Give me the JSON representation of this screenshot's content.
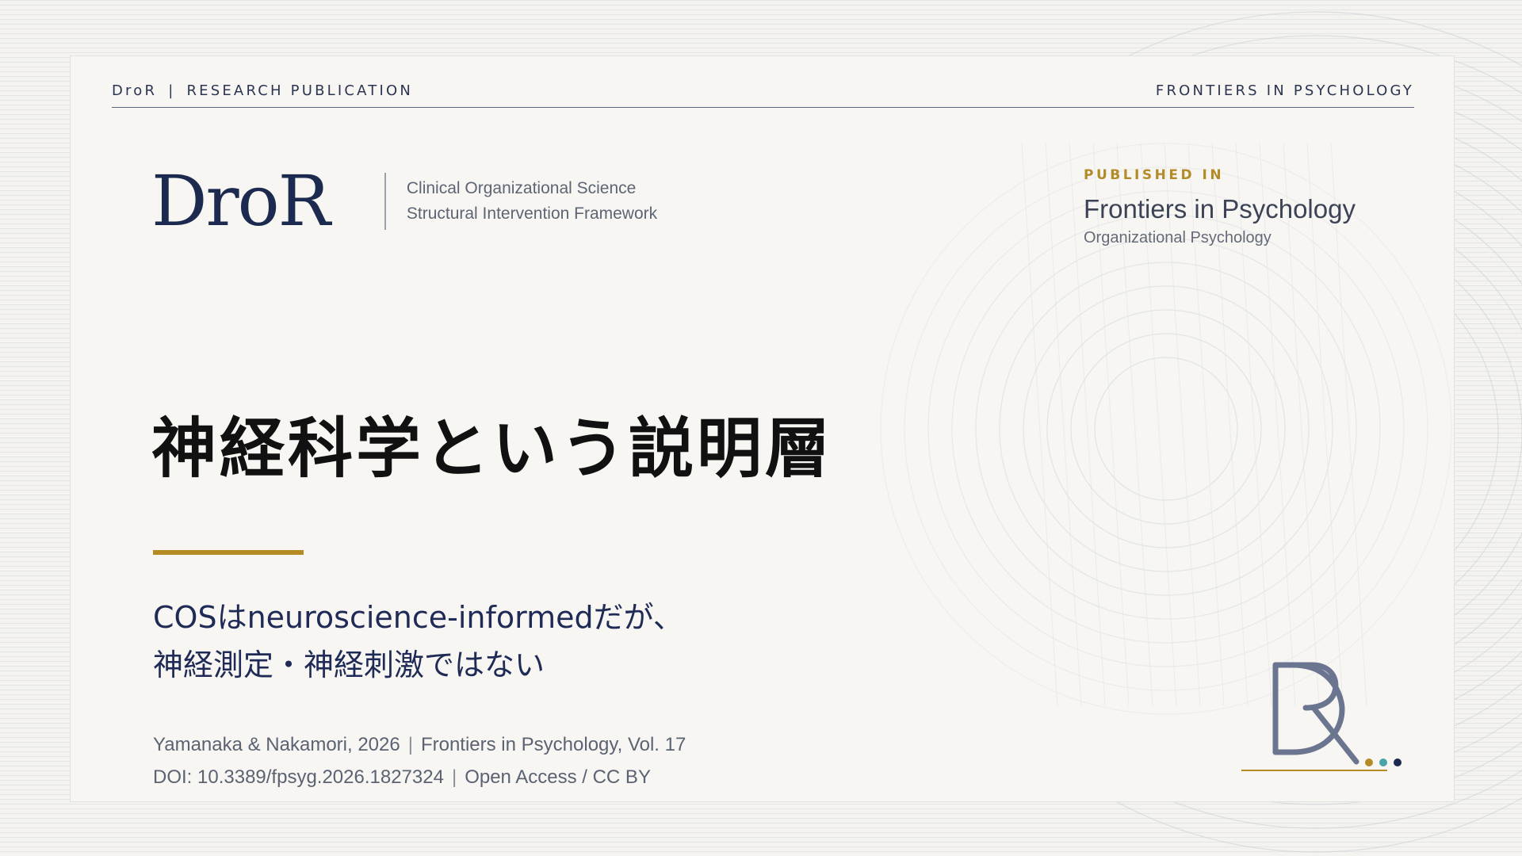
{
  "header": {
    "brand": "DroR",
    "section": "RESEARCH PUBLICATION",
    "journal": "FRONTIERS IN PSYCHOLOGY"
  },
  "brand": {
    "logo": "DroR",
    "tagline_1": "Clinical Organizational Science",
    "tagline_2": "Structural Intervention Framework"
  },
  "published": {
    "label": "PUBLISHED IN",
    "journal": "Frontiers in Psychology",
    "section": "Organizational Psychology"
  },
  "title": "神経科学という説明層",
  "subtitle": {
    "line_1": "COSはneuroscience-informedだが、",
    "line_2": "神経測定・神経刺激ではない"
  },
  "citation": {
    "authors_year": "Yamanaka & Nakamori, 2026",
    "journal_volume": "Frontiers in Psychology, Vol. 17",
    "doi": "DOI: 10.3389/fpsyg.2026.1827324",
    "license": "Open Access / CC BY"
  },
  "colors": {
    "navy": "#1b2a4e",
    "gold": "#b58c24",
    "teal": "#4aa3a8",
    "background": "#f4f3ef"
  },
  "icons": [
    "dr-monogram-mark"
  ]
}
